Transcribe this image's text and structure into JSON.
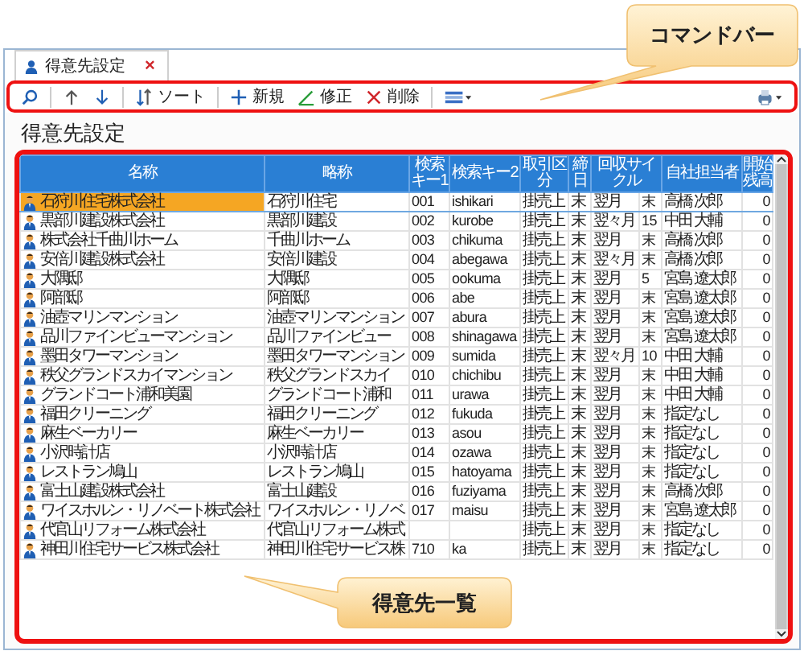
{
  "tab": {
    "title": "得意先設定",
    "close": "×",
    "selected": true
  },
  "toolbar": {
    "buttons": [
      {
        "kind": "search"
      },
      {
        "kind": "up"
      },
      {
        "kind": "down"
      },
      {
        "kind": "sort",
        "label": "ソート"
      },
      {
        "kind": "new",
        "label": "新規"
      },
      {
        "kind": "edit",
        "label": "修正"
      },
      {
        "kind": "delete",
        "label": "削除"
      },
      {
        "kind": "layout"
      }
    ],
    "right": [
      {
        "kind": "print"
      }
    ]
  },
  "callouts": [
    {
      "text": "コマンドバー"
    },
    {
      "text": "得意先一覧"
    }
  ],
  "page_title": "得意先設定",
  "table": {
    "columns": [
      "名称",
      "略称",
      "検索キー1",
      "検索キー2",
      "取引区分",
      "締日",
      "回収サイクル",
      "自社担当者",
      "開始残高"
    ],
    "rows": [
      {
        "name": "石狩川住宅株式会社",
        "short": "石狩川住宅",
        "key1": "001",
        "key2": "ishikari",
        "type": "掛売上",
        "closing": "末",
        "cycle": "翌月",
        "day": "末",
        "rep": "高橋 次郎",
        "balance": "0",
        "selected": true
      },
      {
        "name": "黒部川建設株式会社",
        "short": "黒部川建設",
        "key1": "002",
        "key2": "kurobe",
        "type": "掛売上",
        "closing": "末",
        "cycle": "翌々月",
        "day": "15",
        "rep": "中田 大輔",
        "balance": "0",
        "selected": false
      },
      {
        "name": "株式会社千曲川ホーム",
        "short": "千曲川ホーム",
        "key1": "003",
        "key2": "chikuma",
        "type": "掛売上",
        "closing": "末",
        "cycle": "翌月",
        "day": "末",
        "rep": "高橋 次郎",
        "balance": "0",
        "selected": false
      },
      {
        "name": "安倍川建設株式会社",
        "short": "安倍川建設",
        "key1": "004",
        "key2": "abegawa",
        "type": "掛売上",
        "closing": "末",
        "cycle": "翌々月",
        "day": "末",
        "rep": "高橋 次郎",
        "balance": "0",
        "selected": false
      },
      {
        "name": "大隅邸",
        "short": "大隅邸",
        "key1": "005",
        "key2": "ookuma",
        "type": "掛売上",
        "closing": "末",
        "cycle": "翌月",
        "day": "5",
        "rep": "宮島 遼太郎",
        "balance": "0",
        "selected": false
      },
      {
        "name": "阿部邸",
        "short": "阿部邸",
        "key1": "006",
        "key2": "abe",
        "type": "掛売上",
        "closing": "末",
        "cycle": "翌月",
        "day": "末",
        "rep": "宮島 遼太郎",
        "balance": "0",
        "selected": false
      },
      {
        "name": "油壺マリンマンション",
        "short": "油壺マリンマンション",
        "key1": "007",
        "key2": "abura",
        "type": "掛売上",
        "closing": "末",
        "cycle": "翌月",
        "day": "末",
        "rep": "宮島 遼太郎",
        "balance": "0",
        "selected": false
      },
      {
        "name": "品川ファインビューマンション",
        "short": "品川ファインビュー",
        "key1": "008",
        "key2": "shinagawa",
        "type": "掛売上",
        "closing": "末",
        "cycle": "翌月",
        "day": "末",
        "rep": "宮島 遼太郎",
        "balance": "0",
        "selected": false
      },
      {
        "name": "墨田タワーマンション",
        "short": "墨田タワーマンション",
        "key1": "009",
        "key2": "sumida",
        "type": "掛売上",
        "closing": "末",
        "cycle": "翌々月",
        "day": "10",
        "rep": "中田 大輔",
        "balance": "0",
        "selected": false
      },
      {
        "name": "秩父グランドスカイマンション",
        "short": "秩父グランドスカイ",
        "key1": "010",
        "key2": "chichibu",
        "type": "掛売上",
        "closing": "末",
        "cycle": "翌月",
        "day": "末",
        "rep": "中田 大輔",
        "balance": "0",
        "selected": false
      },
      {
        "name": "グランドコート浦和美園",
        "short": "グランドコート浦和",
        "key1": "011",
        "key2": "urawa",
        "type": "掛売上",
        "closing": "末",
        "cycle": "翌月",
        "day": "末",
        "rep": "中田 大輔",
        "balance": "0",
        "selected": false
      },
      {
        "name": "福田クリーニング",
        "short": "福田クリーニング",
        "key1": "012",
        "key2": "fukuda",
        "type": "掛売上",
        "closing": "末",
        "cycle": "翌月",
        "day": "末",
        "rep": "指定なし",
        "balance": "0",
        "selected": false
      },
      {
        "name": "麻生ベーカリー",
        "short": "麻生ベーカリー",
        "key1": "013",
        "key2": "asou",
        "type": "掛売上",
        "closing": "末",
        "cycle": "翌月",
        "day": "末",
        "rep": "指定なし",
        "balance": "0",
        "selected": false
      },
      {
        "name": "小沢時計店",
        "short": "小沢時計店",
        "key1": "014",
        "key2": "ozawa",
        "type": "掛売上",
        "closing": "末",
        "cycle": "翌月",
        "day": "末",
        "rep": "指定なし",
        "balance": "0",
        "selected": false
      },
      {
        "name": "レストラン鳩山",
        "short": "レストラン鳩山",
        "key1": "015",
        "key2": "hatoyama",
        "type": "掛売上",
        "closing": "末",
        "cycle": "翌月",
        "day": "末",
        "rep": "指定なし",
        "balance": "0",
        "selected": false
      },
      {
        "name": "富士山建設株式会社",
        "short": "富士山建設",
        "key1": "016",
        "key2": "fuziyama",
        "type": "掛売上",
        "closing": "末",
        "cycle": "翌月",
        "day": "末",
        "rep": "高橋 次郎",
        "balance": "0",
        "selected": false
      },
      {
        "name": "ワイスホルン・リノベート株式会社",
        "short": "ワイスホルン・リノベ",
        "key1": "017",
        "key2": "maisu",
        "type": "掛売上",
        "closing": "末",
        "cycle": "翌月",
        "day": "末",
        "rep": "宮島 遼太郎",
        "balance": "0",
        "selected": false
      },
      {
        "name": "代官山リフォーム株式会社",
        "short": "代官山リフォーム株式",
        "type": "掛売上",
        "closing": "末",
        "cycle": "翌月",
        "day": "末",
        "rep": "指定なし",
        "balance": "0",
        "selected": false
      },
      {
        "name": "神田川住宅サービス株式会社",
        "short": "神田川住宅サービス株",
        "key1": "710",
        "key2": "ka",
        "type": "掛売上",
        "closing": "末",
        "cycle": "翌月",
        "day": "末",
        "rep": "指定なし",
        "balance": "0",
        "selected": false
      }
    ]
  }
}
